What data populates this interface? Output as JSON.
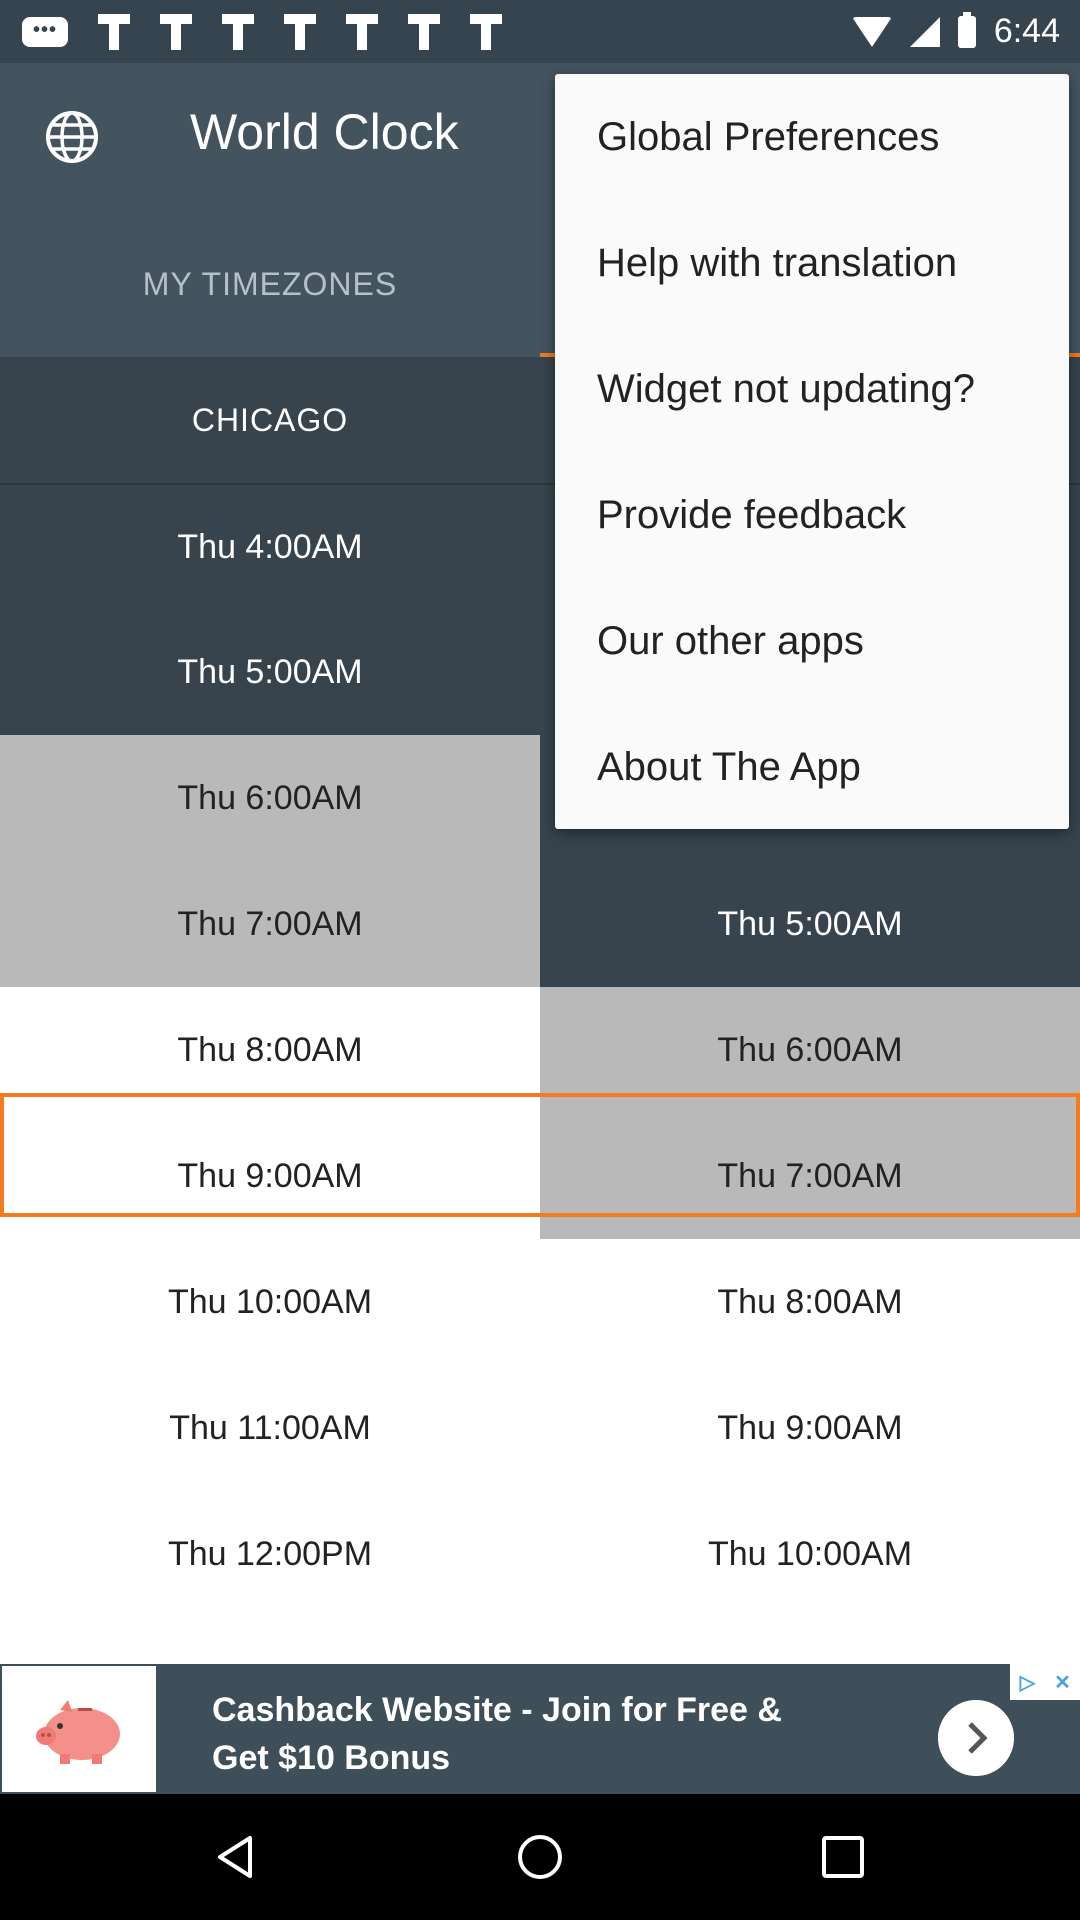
{
  "status_bar": {
    "time": "6:44",
    "icons": [
      "message-icon",
      "flipboard-icon",
      "flipboard-icon",
      "flipboard-icon",
      "flipboard-icon",
      "flipboard-icon",
      "flipboard-icon",
      "flipboard-icon",
      "wifi-icon",
      "signal-icon",
      "battery-icon"
    ]
  },
  "app_bar": {
    "title": "World Clock",
    "icon": "globe-icon"
  },
  "tabs": [
    {
      "label": "MY TIMEZONES",
      "selected": false
    },
    {
      "label": "",
      "selected": true
    }
  ],
  "columns": {
    "left": {
      "city": "CHICAGO",
      "times": [
        "Thu 4:00AM",
        "Thu 5:00AM",
        "Thu 6:00AM",
        "Thu 7:00AM",
        "Thu 8:00AM",
        "Thu 9:00AM",
        "Thu 10:00AM",
        "Thu 11:00AM",
        "Thu 12:00PM"
      ]
    },
    "right": {
      "times_visible": [
        "Thu 5:00AM",
        "Thu 6:00AM",
        "Thu 7:00AM",
        "Thu 8:00AM",
        "Thu 9:00AM",
        "Thu 10:00AM"
      ]
    }
  },
  "overflow_menu": {
    "items": [
      "Global Preferences",
      "Help with translation",
      "Widget not updating?",
      "Provide feedback",
      "Our other apps",
      "About The App"
    ]
  },
  "ad": {
    "text_line1": "Cashback Website - Join for Free &",
    "text_line2": "Get $10 Bonus"
  },
  "colors": {
    "status_bar": "#36444f",
    "app_bar": "#44545f",
    "dark_row": "#37444e",
    "grey_row": "#b9b9b9",
    "accent": "#f47b20"
  }
}
